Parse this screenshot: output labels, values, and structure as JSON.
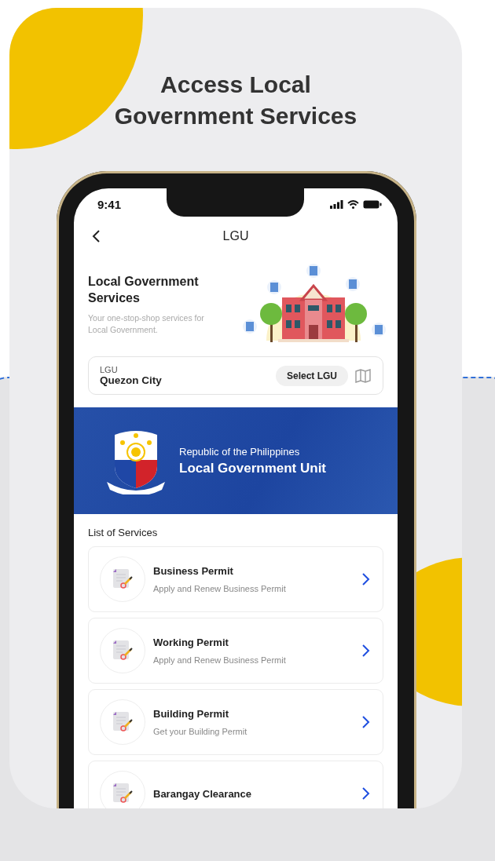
{
  "headline": "Access Local Government Services",
  "status_bar": {
    "time": "9:41"
  },
  "nav": {
    "title": "LGU"
  },
  "hero": {
    "title": "Local Government Services",
    "subtitle": "Your one-stop-shop services for Local Government."
  },
  "lgu_selector": {
    "label": "LGU",
    "value": "Quezon City",
    "button": "Select LGU"
  },
  "banner": {
    "subtitle": "Republic of the Philippines",
    "title": "Local Government Unit"
  },
  "services": {
    "heading": "List of Services",
    "items": [
      {
        "title": "Business Permit",
        "description": "Apply and Renew Business Permit"
      },
      {
        "title": "Working Permit",
        "description": "Apply and Renew Business Permit"
      },
      {
        "title": "Building Permit",
        "description": "Get your Building Permit"
      },
      {
        "title": "Barangay Clearance"
      }
    ]
  }
}
